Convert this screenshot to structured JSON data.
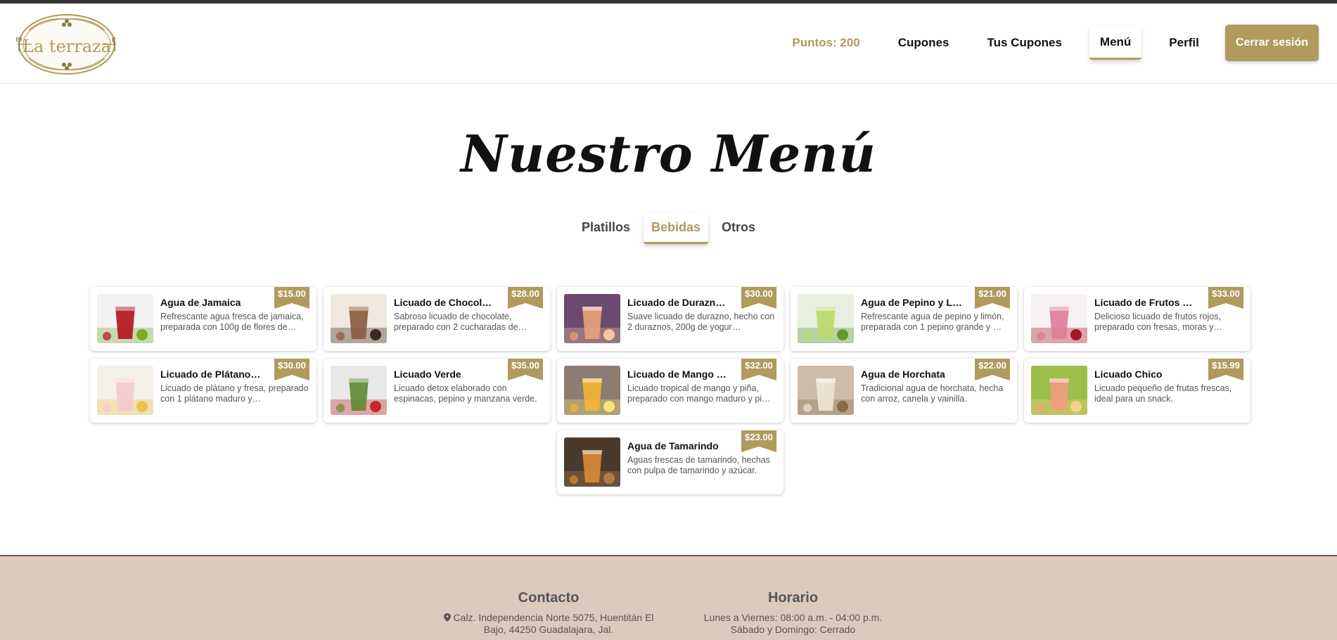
{
  "header": {
    "logo_text": "La terraza",
    "nav": {
      "points": "Puntos: 200",
      "coupons": "Cupones",
      "my_coupons": "Tus Cupones",
      "menu": "Menú",
      "profile": "Perfil",
      "logout": "Cerrar sesión"
    }
  },
  "page": {
    "title": "Nuestro Menú",
    "tabs": [
      "Platillos",
      "Bebidas",
      "Otros"
    ],
    "active_tab": "Bebidas"
  },
  "items": [
    {
      "name": "Agua de Jamaica",
      "desc": "Refrescante agua fresca de jamaica, preparada con 100g de flores de…",
      "price": "$15.00",
      "colors": [
        "#b3121e",
        "#f2f2f2",
        "#7cab2c"
      ]
    },
    {
      "name": "Licuado de Chocol…",
      "desc": "Sabroso licuado de chocolate, preparado con 2 cucharadas de…",
      "price": "$28.00",
      "colors": [
        "#8a5a3c",
        "#efe8df",
        "#3a2a20"
      ]
    },
    {
      "name": "Licuado de Durazn…",
      "desc": "Suave licuado de durazno, hecho con 2 duraznos, 200g de yogur…",
      "price": "$30.00",
      "colors": [
        "#e9a27a",
        "#6b4a6e",
        "#f3c7a2"
      ]
    },
    {
      "name": "Agua de Pepino y L…",
      "desc": "Refrescante agua de pepino y limón, preparada con 1 pepino grande y …",
      "price": "$21.00",
      "colors": [
        "#b8d96a",
        "#e8efe0",
        "#5f9a2e"
      ]
    },
    {
      "name": "Licuado de Frutos …",
      "desc": "Delicioso licuado de frutos rojos, preparado con fresas, moras y…",
      "price": "$33.00",
      "colors": [
        "#e07b98",
        "#f6f1f2",
        "#a5162c"
      ]
    },
    {
      "name": "Licuado de Plátano…",
      "desc": "Licuado de plátano y fresa, preparado con 1 plátano maduro y…",
      "price": "$30.00",
      "colors": [
        "#f3c8d2",
        "#f4f0ea",
        "#e9c34b"
      ]
    },
    {
      "name": "Licuado Verde",
      "desc": "Licuado detox elaborado con espinacas, pepino y manzana verde.",
      "price": "$35.00",
      "colors": [
        "#5e8a32",
        "#e8e8e8",
        "#c6262c"
      ]
    },
    {
      "name": "Licuado de Mango …",
      "desc": "Licuado tropical de mango y piña, preparado con mango maduro y pi…",
      "price": "$32.00",
      "colors": [
        "#f5b531",
        "#8c7c74",
        "#fde17c"
      ]
    },
    {
      "name": "Agua de Horchata",
      "desc": "Tradicional agua de horchata, hecha con arroz, canela y vainilla.",
      "price": "$22.00",
      "colors": [
        "#efe4d5",
        "#cdbda8",
        "#8a6a4c"
      ]
    },
    {
      "name": "Licuado Chico",
      "desc": "Licuado pequeño de frutas frescas, ideal para un snack.",
      "price": "$15.99",
      "colors": [
        "#f29b7f",
        "#9cbf4a",
        "#f4d28a"
      ]
    },
    {
      "name": "Agua de Tamarindo",
      "desc": "Aguas frescas de tamarindo, hechas con pulpa de tamarindo y azúcar.",
      "price": "$23.00",
      "colors": [
        "#d98a3a",
        "#4a3a2e",
        "#b07a4a"
      ]
    }
  ],
  "footer": {
    "contact": {
      "title": "Contacto",
      "line1": "Calz. Independencia Norte 5075, Huentitán El",
      "line2": "Bajo, 44250 Guadalajara, Jal."
    },
    "hours": {
      "title": "Horario",
      "line1": "Lunes a Viernes: 08:00 a.m. - 04:00 p.m.",
      "line2": "Sábado y Domingo: Cerrado"
    }
  },
  "colors": {
    "accent": "#b09a5d",
    "footer_bg": "#dacbbd",
    "topbar": "#333333"
  }
}
